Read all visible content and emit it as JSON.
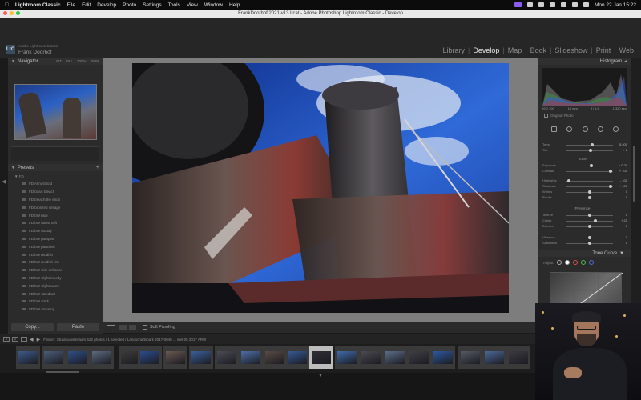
{
  "menubar": {
    "app_name": "Lightroom Classic",
    "items": [
      "File",
      "Edit",
      "Develop",
      "Photo",
      "Settings",
      "Tools",
      "View",
      "Window",
      "Help"
    ],
    "datetime": "Mon 22 Jan 15:22"
  },
  "window": {
    "title": "FrankDoorhof 2021-v13.lrcat - Adobe Photoshop Lightroom Classic - Develop"
  },
  "identity": {
    "logo": "LrC",
    "subtitle": "Adobe Lightroom Classic",
    "name": "Frank Doorhof"
  },
  "modules": {
    "items": [
      "Library",
      "Develop",
      "Map",
      "Book",
      "Slideshow",
      "Print",
      "Web"
    ],
    "active": "Develop"
  },
  "left_panel": {
    "navigator_title": "Navigator",
    "navigator_options": [
      "FIT",
      "FILL",
      "100%",
      "200%"
    ],
    "presets_title": "Presets",
    "preset_folder": "FD",
    "presets": [
      "FD Almost lost",
      "FD basic bleach",
      "FD bleach the ends",
      "FD bronzed vintage",
      "FD bW blue",
      "FD bW faded soft",
      "FD bW moody",
      "FD bW pumped",
      "FD bW punched",
      "FD bW reddish",
      "FD bW reddish kim",
      "FD bW skin enhance",
      "FD bW slight moody",
      "FD bW slight warm",
      "FD bW standard",
      "FD bW stark",
      "FD bW stunning"
    ],
    "copy_label": "Copy...",
    "paste_label": "Paste"
  },
  "toolbar": {
    "soft_proofing_label": "Soft Proofing"
  },
  "right_panel": {
    "histogram_title": "Histogram",
    "histogram_stats": [
      "ISO 100",
      "14 mm",
      "f / 5.6",
      "1/320 sec"
    ],
    "original_photo_label": "Original Photo",
    "tone_title": "Tone",
    "presence_title": "Presence",
    "sliders": [
      {
        "label": "Temp",
        "value": "5,200",
        "pos": 0.55
      },
      {
        "label": "Tint",
        "value": "+ 8",
        "pos": 0.52
      },
      {
        "label": "Exposure",
        "value": "+ 0.20",
        "pos": 0.53
      },
      {
        "label": "Contrast",
        "value": "+ 100",
        "pos": 0.95
      },
      {
        "label": "Highlights",
        "value": "- 100",
        "pos": 0.05
      },
      {
        "label": "Shadows",
        "value": "+ 100",
        "pos": 0.95
      },
      {
        "label": "Whites",
        "value": "0",
        "pos": 0.5
      },
      {
        "label": "Blacks",
        "value": "0",
        "pos": 0.5
      },
      {
        "label": "Texture",
        "value": "0",
        "pos": 0.5
      },
      {
        "label": "Clarity",
        "value": "+ 21",
        "pos": 0.62
      },
      {
        "label": "Dehaze",
        "value": "0",
        "pos": 0.5
      },
      {
        "label": "Vibrance",
        "value": "0",
        "pos": 0.5
      },
      {
        "label": "Saturation",
        "value": "0",
        "pos": 0.5
      }
    ],
    "tone_curve_title": "Tone Curve",
    "tone_curve_adjust_label": "Adjust"
  },
  "filmstrip": {
    "page_buttons": [
      "1",
      "2"
    ],
    "info": "Folder : Straatkunstenaars     522 photos / 1 selected / Landschaftspark 2017-0040 ... met 05 2017 ARW"
  },
  "colors": {
    "accent_active_module": "#e8e8e8",
    "menubar_accent": "#8a5cf5",
    "traffic_red": "#ff5f57",
    "traffic_yellow": "#febc2e",
    "traffic_green": "#28c840"
  }
}
